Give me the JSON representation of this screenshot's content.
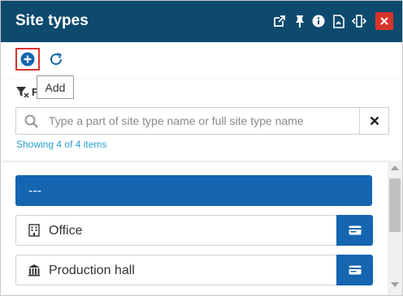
{
  "header": {
    "title": "Site types",
    "icons": [
      "open-external-icon",
      "pin-icon",
      "info-icon",
      "pdf-icon",
      "resize-icon",
      "close-icon"
    ],
    "close_color": "#d9342b",
    "background_color": "#0d4a6e"
  },
  "toolbar": {
    "add_icon": "plus-circle-icon",
    "refresh_icon": "refresh-icon",
    "add_tooltip": "Add"
  },
  "filter": {
    "label": "F",
    "search": {
      "value": "",
      "placeholder": "Type a part of site type name or full site type name"
    },
    "showing_text": "Showing 4 of 4 items"
  },
  "list": {
    "items": [
      {
        "label": "---",
        "icon": "",
        "selected": true
      },
      {
        "label": "Office",
        "icon": "building-icon",
        "selected": false
      },
      {
        "label": "Production hall",
        "icon": "factory-icon",
        "selected": false
      }
    ],
    "selected_color": "#1565b0"
  }
}
